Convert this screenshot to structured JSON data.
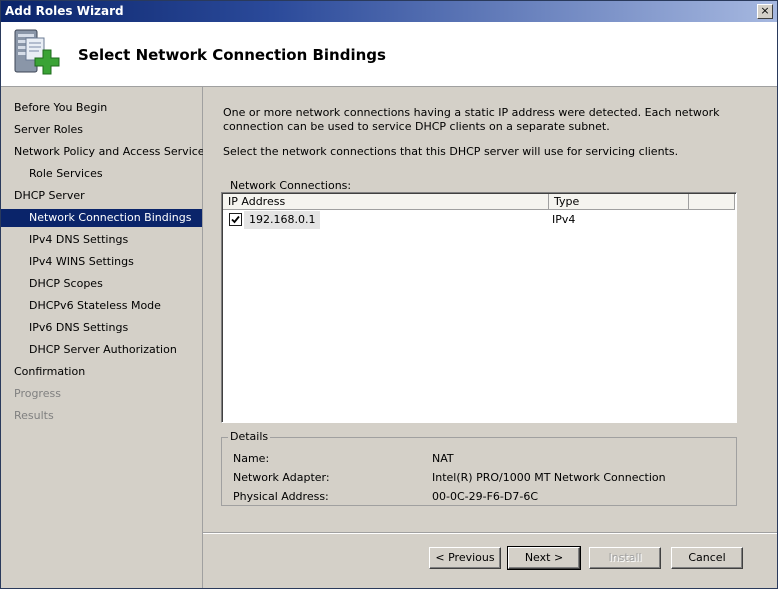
{
  "window": {
    "title": "Add Roles Wizard",
    "close_glyph": "×"
  },
  "header": {
    "icon": "server-roles-add-icon",
    "title": "Select Network Connection Bindings"
  },
  "nav": {
    "items": [
      {
        "label": "Before You Begin",
        "level": 1,
        "state": "normal"
      },
      {
        "label": "Server Roles",
        "level": 1,
        "state": "normal"
      },
      {
        "label": "Network Policy and Access Services",
        "level": 1,
        "state": "normal"
      },
      {
        "label": "Role Services",
        "level": 2,
        "state": "normal"
      },
      {
        "label": "DHCP Server",
        "level": 1,
        "state": "normal"
      },
      {
        "label": "Network Connection Bindings",
        "level": 2,
        "state": "selected"
      },
      {
        "label": "IPv4 DNS Settings",
        "level": 2,
        "state": "normal"
      },
      {
        "label": "IPv4 WINS Settings",
        "level": 2,
        "state": "normal"
      },
      {
        "label": "DHCP Scopes",
        "level": 2,
        "state": "normal"
      },
      {
        "label": "DHCPv6 Stateless Mode",
        "level": 2,
        "state": "normal"
      },
      {
        "label": "IPv6 DNS Settings",
        "level": 2,
        "state": "normal"
      },
      {
        "label": "DHCP Server Authorization",
        "level": 2,
        "state": "normal"
      },
      {
        "label": "Confirmation",
        "level": 1,
        "state": "normal"
      },
      {
        "label": "Progress",
        "level": 1,
        "state": "disabled"
      },
      {
        "label": "Results",
        "level": 1,
        "state": "disabled"
      }
    ]
  },
  "main": {
    "intro": "One or more network connections having a static IP address were detected. Each network connection can be used to service DHCP clients on a separate subnet.",
    "instruction": "Select the network connections that this DHCP server will use for servicing clients.",
    "connections_label": "Network Connections:",
    "columns": [
      "IP Address",
      "Type",
      ""
    ],
    "rows": [
      {
        "checked": true,
        "ip": "192.168.0.1",
        "type": "IPv4"
      }
    ],
    "details": {
      "legend": "Details",
      "fields": [
        {
          "label": "Name:",
          "value": "NAT"
        },
        {
          "label": "Network Adapter:",
          "value": "Intel(R) PRO/1000 MT Network Connection"
        },
        {
          "label": "Physical Address:",
          "value": "00-0C-29-F6-D7-6C"
        }
      ]
    }
  },
  "buttons": {
    "previous": "< Previous",
    "next": "Next >",
    "install": "Install",
    "cancel": "Cancel"
  },
  "colors": {
    "selection": "#0a246a",
    "dialog_bg": "#d4d0c8",
    "disabled_text": "#808080"
  }
}
